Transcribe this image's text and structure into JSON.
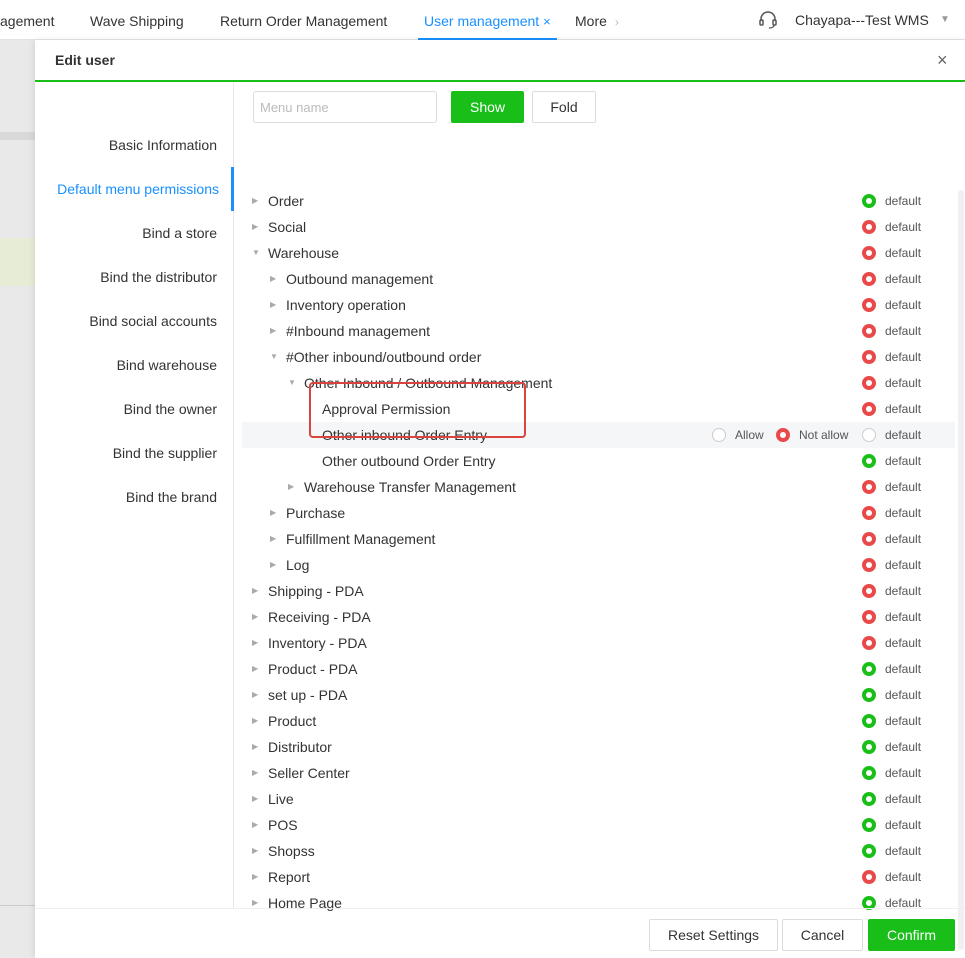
{
  "top_tabs": [
    {
      "label": "agement",
      "active": false
    },
    {
      "label": "Wave Shipping",
      "active": false
    },
    {
      "label": "Return Order Management",
      "active": false
    },
    {
      "label": "User management",
      "active": true,
      "close": "×"
    },
    {
      "label": "More",
      "active": false
    }
  ],
  "account": {
    "name": "Chayapa---Test WMS"
  },
  "dialog": {
    "title": "Edit user",
    "close": "×"
  },
  "sidebar": {
    "items": [
      {
        "label": "Basic Information",
        "active": false
      },
      {
        "label": "Default menu permissions",
        "active": true
      },
      {
        "label": "Bind a store",
        "active": false
      },
      {
        "label": "Bind the distributor",
        "active": false
      },
      {
        "label": "Bind social accounts",
        "active": false
      },
      {
        "label": "Bind warehouse",
        "active": false
      },
      {
        "label": "Bind the owner",
        "active": false
      },
      {
        "label": "Bind the supplier",
        "active": false
      },
      {
        "label": "Bind the brand",
        "active": false
      }
    ]
  },
  "toolbar": {
    "search_placeholder": "Menu name",
    "show_label": "Show",
    "fold_label": "Fold"
  },
  "colors": {
    "green": "#19be19",
    "red": "#e84a4a",
    "blue": "#1890ff"
  },
  "tree": {
    "default_label": "default",
    "allow_label": "Allow",
    "not_allow_label": "Not allow",
    "rows": [
      {
        "label": "Order",
        "depth": 0,
        "caret": "right",
        "status": "green"
      },
      {
        "label": "Social",
        "depth": 0,
        "caret": "right",
        "status": "red"
      },
      {
        "label": "Warehouse",
        "depth": 0,
        "caret": "down",
        "status": "red"
      },
      {
        "label": "Outbound management",
        "depth": 1,
        "caret": "right",
        "status": "red"
      },
      {
        "label": "Inventory operation",
        "depth": 1,
        "caret": "right",
        "status": "red"
      },
      {
        "label": "#Inbound management",
        "depth": 1,
        "caret": "right",
        "status": "red"
      },
      {
        "label": "#Other inbound/outbound order",
        "depth": 1,
        "caret": "down",
        "status": "red"
      },
      {
        "label": "Other Inbound / Outbound Management",
        "depth": 2,
        "caret": "down",
        "status": "red"
      },
      {
        "label": "Approval Permission",
        "depth": 3,
        "caret": "none",
        "status": "red"
      },
      {
        "label": "Other inbound Order Entry",
        "depth": 3,
        "caret": "none",
        "status": "empty",
        "hover": true,
        "selected": "not_allow"
      },
      {
        "label": "Other outbound Order Entry",
        "depth": 3,
        "caret": "none",
        "status": "green"
      },
      {
        "label": "Warehouse Transfer Management",
        "depth": 2,
        "caret": "right",
        "status": "red"
      },
      {
        "label": "Purchase",
        "depth": 1,
        "caret": "right",
        "status": "red"
      },
      {
        "label": "Fulfillment Management",
        "depth": 1,
        "caret": "right",
        "status": "red"
      },
      {
        "label": "Log",
        "depth": 1,
        "caret": "right",
        "status": "red"
      },
      {
        "label": "Shipping - PDA",
        "depth": 0,
        "caret": "right",
        "status": "red"
      },
      {
        "label": "Receiving - PDA",
        "depth": 0,
        "caret": "right",
        "status": "red"
      },
      {
        "label": "Inventory - PDA",
        "depth": 0,
        "caret": "right",
        "status": "red"
      },
      {
        "label": "Product - PDA",
        "depth": 0,
        "caret": "right",
        "status": "green"
      },
      {
        "label": "set up - PDA",
        "depth": 0,
        "caret": "right",
        "status": "green"
      },
      {
        "label": "Product",
        "depth": 0,
        "caret": "right",
        "status": "green"
      },
      {
        "label": "Distributor",
        "depth": 0,
        "caret": "right",
        "status": "green"
      },
      {
        "label": "Seller Center",
        "depth": 0,
        "caret": "right",
        "status": "green"
      },
      {
        "label": "Live",
        "depth": 0,
        "caret": "right",
        "status": "green"
      },
      {
        "label": "POS",
        "depth": 0,
        "caret": "right",
        "status": "green"
      },
      {
        "label": "Shopss",
        "depth": 0,
        "caret": "right",
        "status": "green"
      },
      {
        "label": "Report",
        "depth": 0,
        "caret": "right",
        "status": "red"
      },
      {
        "label": "Home Page",
        "depth": 0,
        "caret": "right",
        "status": "green"
      }
    ]
  },
  "footer": {
    "reset_label": "Reset Settings",
    "cancel_label": "Cancel",
    "confirm_label": "Confirm"
  }
}
